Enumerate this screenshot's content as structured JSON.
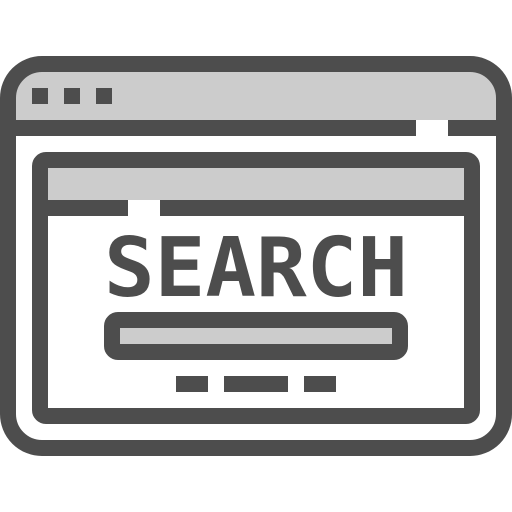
{
  "icon": {
    "name": "search-website-icon",
    "word": "SEARCH"
  },
  "colors": {
    "outline": "#4d4d4d",
    "fill": "#cccccc",
    "background": "#ffffff"
  }
}
